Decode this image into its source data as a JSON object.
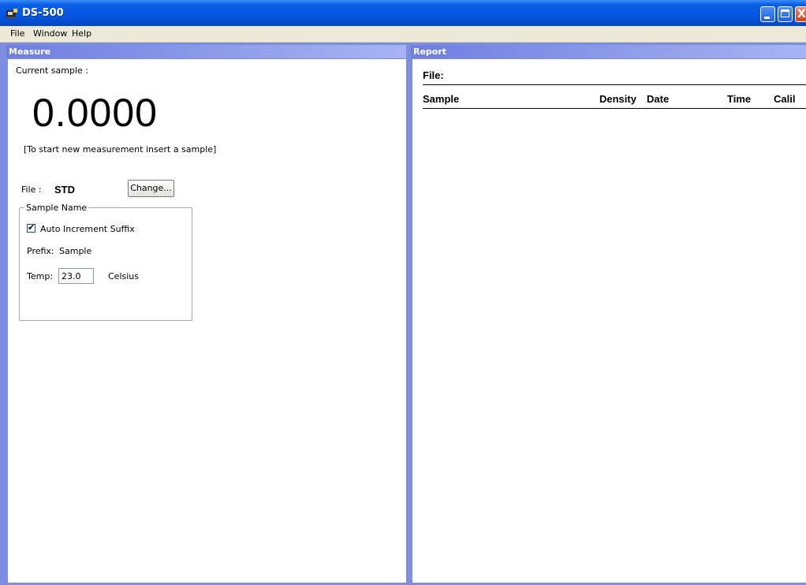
{
  "window": {
    "title": "DS-500",
    "controls": {
      "minimize": "minimize",
      "maximize": "maximize",
      "close": "X"
    }
  },
  "menu": {
    "items": [
      "File",
      "Window",
      "Help"
    ]
  },
  "measure": {
    "header": "Measure",
    "current_sample_label": "Current sample :",
    "reading": "0.0000",
    "instruction": "[To start new measurement insert a sample]",
    "file_label": "File :",
    "file_value": "STD",
    "change_button": "Change...",
    "sample_name_group": {
      "legend": "Sample Name",
      "auto_increment_label": "Auto Increment Suffix",
      "auto_increment_checked": true,
      "prefix_label": "Prefix:",
      "prefix_value": "Sample",
      "temp_label": "Temp:",
      "temp_value": "23.0",
      "temp_unit": "Celsius"
    }
  },
  "report": {
    "header": "Report",
    "file_label": "File:",
    "columns": [
      "Sample",
      "Density",
      "Date",
      "Time",
      "Calil"
    ]
  }
}
